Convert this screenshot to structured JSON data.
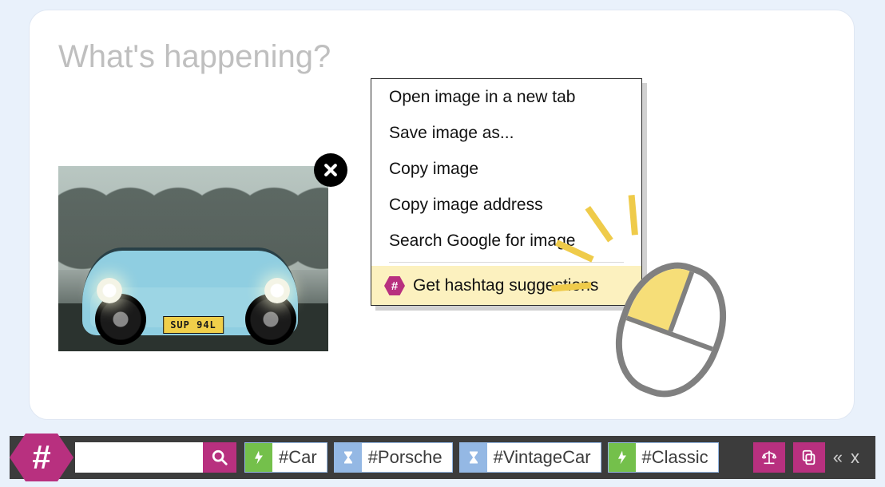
{
  "compose": {
    "placeholder": "What's happening?",
    "image": {
      "plate": "SUP 94L"
    }
  },
  "context_menu": {
    "items": [
      "Open image in a new tab",
      "Save image as...",
      "Copy image",
      "Copy image address",
      "Search Google for image"
    ],
    "highlighted": "Get hashtag suggestions"
  },
  "toolbar": {
    "brand_glyph": "#",
    "search": {
      "value": "",
      "placeholder": ""
    },
    "tags": [
      {
        "icon": "bolt",
        "label": "#Car"
      },
      {
        "icon": "hourglass",
        "label": "#Porsche"
      },
      {
        "icon": "hourglass",
        "label": "#VintageCar"
      },
      {
        "icon": "bolt",
        "label": "#Classic"
      }
    ],
    "collapse_glyph": "«",
    "close_glyph": "x"
  }
}
